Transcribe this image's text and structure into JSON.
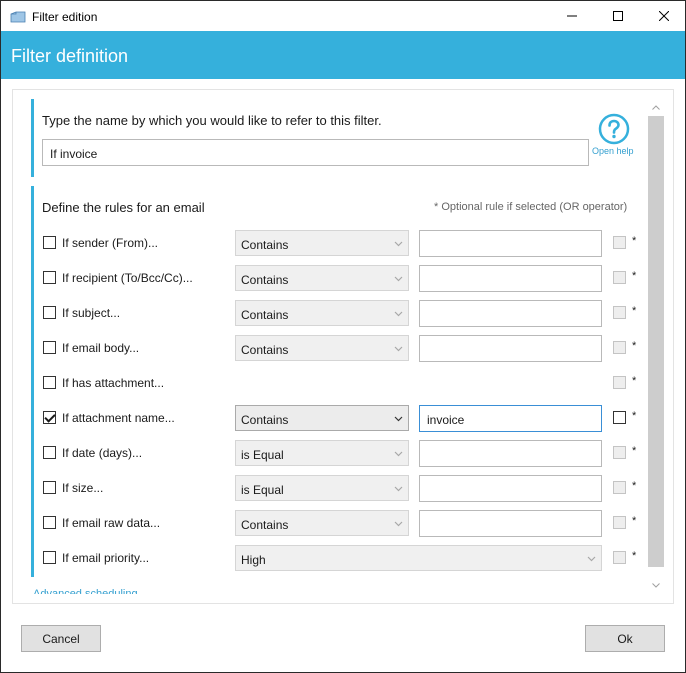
{
  "window": {
    "title": "Filter edition",
    "controls": {
      "minimize": "minimize-icon",
      "maximize": "maximize-icon",
      "close": "close-icon"
    }
  },
  "header": {
    "title": "Filter definition"
  },
  "name_section": {
    "label": "Type the name by which you would like to refer to this filter.",
    "value": "If invoice",
    "help_label": "Open help"
  },
  "rules_section": {
    "label": "Define the rules for an email",
    "optional_note": "* Optional rule if selected (OR operator)",
    "optional_marker": "*",
    "rules": [
      {
        "label": "If sender (From)...",
        "checked": false,
        "operator": "Contains",
        "value": "",
        "optional": false
      },
      {
        "label": "If recipient (To/Bcc/Cc)...",
        "checked": false,
        "operator": "Contains",
        "value": "",
        "optional": false
      },
      {
        "label": "If subject...",
        "checked": false,
        "operator": "Contains",
        "value": "",
        "optional": false
      },
      {
        "label": "If email body...",
        "checked": false,
        "operator": "Contains",
        "value": "",
        "optional": false
      },
      {
        "label": "If has attachment...",
        "checked": false,
        "operator": "",
        "value": "",
        "optional": false
      },
      {
        "label": "If attachment name...",
        "checked": true,
        "operator": "Contains",
        "value": "invoice",
        "optional": false
      },
      {
        "label": "If date (days)...",
        "checked": false,
        "operator": "is Equal",
        "value": "",
        "optional": false
      },
      {
        "label": "If size...",
        "checked": false,
        "operator": "is Equal",
        "value": "",
        "optional": false
      },
      {
        "label": "If email raw data...",
        "checked": false,
        "operator": "Contains",
        "value": "",
        "optional": false
      },
      {
        "label": "If email priority...",
        "checked": false,
        "operator": "High",
        "value": "",
        "optional": false
      }
    ]
  },
  "footer": {
    "advanced_link": "Advanced scheduling...",
    "cancel_label": "Cancel",
    "ok_label": "Ok"
  },
  "colors": {
    "accent": "#35b0dc",
    "link": "#35a0d0"
  }
}
